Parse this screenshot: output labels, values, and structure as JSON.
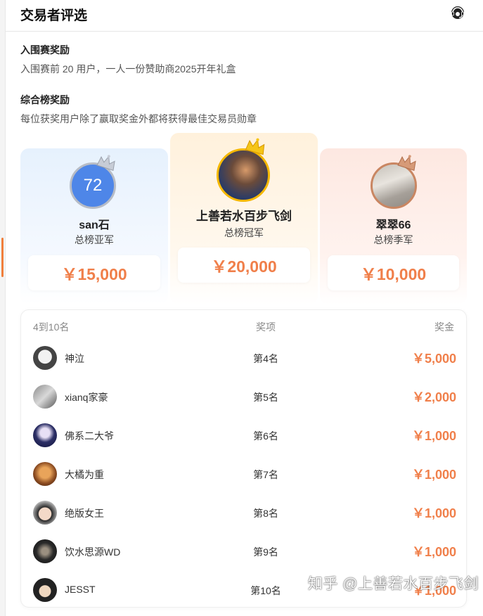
{
  "header": {
    "title": "交易者评选",
    "support_icon": "headset-icon"
  },
  "sections": [
    {
      "title": "入围赛奖励",
      "desc": "入围赛前 20 用户，一人一份赞助商2025开年礼盒"
    },
    {
      "title": "综合榜奖励",
      "desc": "每位获奖用户除了赢取奖金外都将获得最佳交易员勋章"
    }
  ],
  "podium": {
    "second": {
      "avatar_text": "72",
      "name": "san石",
      "rank": "总榜亚军",
      "prize": "￥15,000",
      "crown": "silver-crown-icon"
    },
    "first": {
      "name": "上善若水百步飞剑",
      "rank": "总榜冠军",
      "prize": "￥20,000",
      "crown": "gold-crown-icon"
    },
    "third": {
      "name": "翠翠66",
      "rank": "总榜季军",
      "prize": "￥10,000",
      "crown": "bronze-crown-icon"
    }
  },
  "list": {
    "headers": {
      "range": "4到10名",
      "award": "奖项",
      "prize": "奖金"
    },
    "rows": [
      {
        "name": "神泣",
        "rank": "第4名",
        "amount": "￥5,000"
      },
      {
        "name": "xianq家豪",
        "rank": "第5名",
        "amount": "￥2,000"
      },
      {
        "name": "佛系二大爷",
        "rank": "第6名",
        "amount": "￥1,000"
      },
      {
        "name": "大橘为重",
        "rank": "第7名",
        "amount": "￥1,000"
      },
      {
        "name": "绝版女王",
        "rank": "第8名",
        "amount": "￥1,000"
      },
      {
        "name": "饮水思源WD",
        "rank": "第9名",
        "amount": "￥1,000"
      },
      {
        "name": "JESST",
        "rank": "第10名",
        "amount": "￥1,000"
      }
    ]
  },
  "watermark": "知乎 @上善若水百步飞剑",
  "colors": {
    "accent": "#f07f4a",
    "gold": "#f5b800",
    "silver": "#b7bcc6",
    "bronze": "#c98662",
    "avatar_blue": "#4e86e8"
  }
}
